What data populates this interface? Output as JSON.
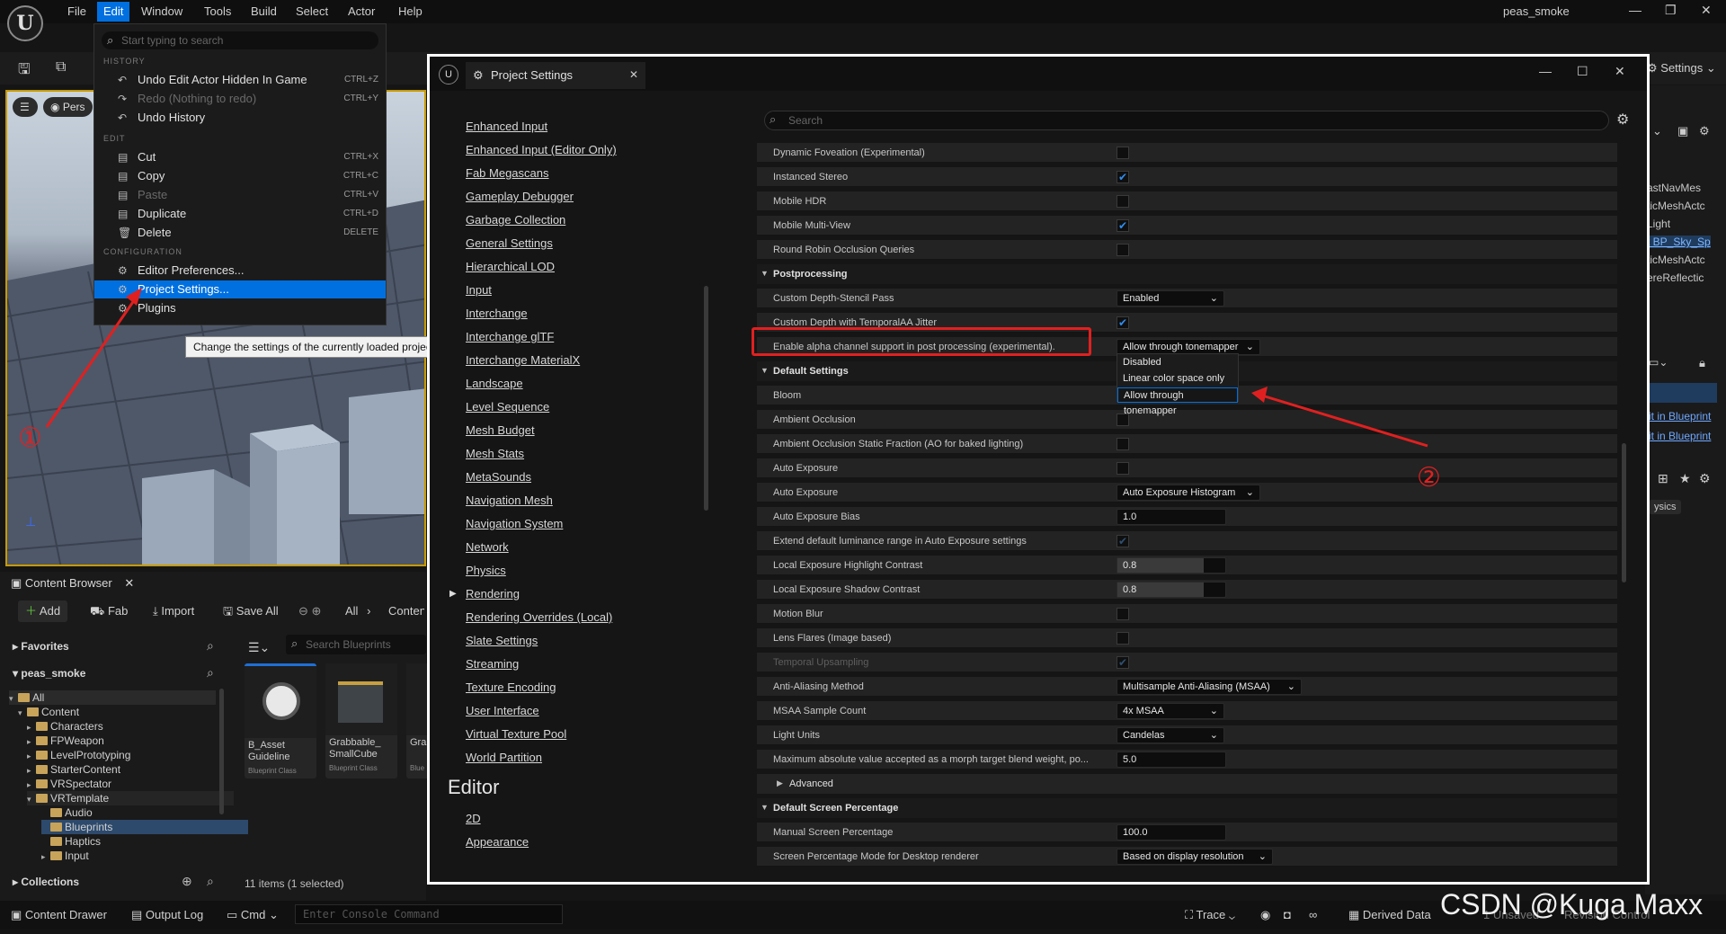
{
  "main": {
    "menus": [
      "File",
      "Edit",
      "Window",
      "Tools",
      "Build",
      "Select",
      "Actor",
      "Help"
    ],
    "active_menu": "Edit",
    "project_name": "peas_smoke",
    "settings_label": "Settings"
  },
  "edit_menu": {
    "search_placeholder": "Start typing to search",
    "history_header": "HISTORY",
    "edit_header": "EDIT",
    "config_header": "CONFIGURATION",
    "history": [
      {
        "label": "Undo Edit Actor Hidden In Game",
        "shortcut": "CTRL+Z"
      },
      {
        "label": "Redo (Nothing to redo)",
        "shortcut": "CTRL+Y"
      },
      {
        "label": "Undo History",
        "shortcut": ""
      }
    ],
    "edit": [
      {
        "label": "Cut",
        "shortcut": "CTRL+X"
      },
      {
        "label": "Copy",
        "shortcut": "CTRL+C"
      },
      {
        "label": "Paste",
        "shortcut": "CTRL+V"
      },
      {
        "label": "Duplicate",
        "shortcut": "CTRL+D"
      },
      {
        "label": "Delete",
        "shortcut": "DELETE"
      }
    ],
    "config": [
      {
        "label": "Editor Preferences..."
      },
      {
        "label": "Project Settings..."
      },
      {
        "label": "Plugins"
      }
    ],
    "tooltip": "Change the settings of the currently loaded project"
  },
  "viewport": {
    "view_label": "Pers"
  },
  "content_browser": {
    "title": "Content Browser",
    "add": "Add",
    "fab": "Fab",
    "import": "Import",
    "save_all": "Save All",
    "path_all": "All",
    "path_content": "Content",
    "favorites": "Favorites",
    "project": "peas_smoke",
    "collections": "Collections",
    "search_placeholder": "Search Blueprints",
    "tree": [
      "All",
      "Content",
      "Characters",
      "FPWeapon",
      "LevelPrototyping",
      "StarterContent",
      "VRSpectator",
      "VRTemplate",
      "Audio",
      "Blueprints",
      "Haptics",
      "Input"
    ],
    "assets": [
      {
        "name": "B_Asset Guideline",
        "class": "Blueprint Class"
      },
      {
        "name": "Grabbable_ SmallCube",
        "class": "Blueprint Class"
      },
      {
        "name": "Grab Com",
        "class": "Blue"
      }
    ],
    "count": "11 items (1 selected)"
  },
  "statusbar": {
    "content_drawer": "Content Drawer",
    "output_log": "Output Log",
    "cmd": "Cmd",
    "console_placeholder": "Enter Console Command",
    "trace": "Trace",
    "derived_data": "Derived Data",
    "unsaved": "1 Unsaved",
    "revision": "Revision Control"
  },
  "right_panel": {
    "items": [
      "astNavMes",
      "ticMeshActc",
      "Light",
      "t BP_Sky_Sp",
      "ticMeshActc",
      "ereReflectic"
    ],
    "links": [
      "it in Blueprint",
      "it in Blueprint"
    ],
    "physics": "ysics"
  },
  "project_settings": {
    "title": "Project Settings",
    "search_placeholder": "Search",
    "nav": [
      "Enhanced Input",
      "Enhanced Input (Editor Only)",
      "Fab Megascans",
      "Gameplay Debugger",
      "Garbage Collection",
      "General Settings",
      "Hierarchical LOD",
      "Input",
      "Interchange",
      "Interchange glTF",
      "Interchange MaterialX",
      "Landscape",
      "Level Sequence",
      "Mesh Budget",
      "Mesh Stats",
      "MetaSounds",
      "Navigation Mesh",
      "Navigation System",
      "Network",
      "Physics",
      "Rendering",
      "Rendering Overrides (Local)",
      "Slate Settings",
      "Streaming",
      "Texture Encoding",
      "User Interface",
      "Virtual Texture Pool",
      "World Partition"
    ],
    "editor_header": "Editor",
    "editor_nav": [
      "2D",
      "Appearance"
    ],
    "rows": [
      {
        "type": "check",
        "name": "Dynamic Foveation (Experimental)",
        "checked": false
      },
      {
        "type": "check",
        "name": "Instanced Stereo",
        "checked": true
      },
      {
        "type": "check",
        "name": "Mobile HDR",
        "checked": false
      },
      {
        "type": "check",
        "name": "Mobile Multi-View",
        "checked": true
      },
      {
        "type": "check",
        "name": "Round Robin Occlusion Queries",
        "checked": false
      },
      {
        "type": "section",
        "name": "Postprocessing"
      },
      {
        "type": "dropdown",
        "name": "Custom Depth-Stencil Pass",
        "value": "Enabled"
      },
      {
        "type": "check",
        "name": "Custom Depth with TemporalAA Jitter",
        "checked": true
      },
      {
        "type": "dropdown",
        "name": "Enable alpha channel support in post processing (experimental).",
        "value": "Allow through tonemapper"
      },
      {
        "type": "section",
        "name": "Default Settings"
      },
      {
        "type": "blank",
        "name": "Bloom"
      },
      {
        "type": "check",
        "name": "Ambient Occlusion",
        "checked": false
      },
      {
        "type": "check",
        "name": "Ambient Occlusion Static Fraction (AO for baked lighting)",
        "checked": false
      },
      {
        "type": "check",
        "name": "Auto Exposure",
        "checked": false
      },
      {
        "type": "dropdown",
        "name": "Auto Exposure",
        "value": "Auto Exposure Histogram"
      },
      {
        "type": "number",
        "name": "Auto Exposure Bias",
        "value": "1.0"
      },
      {
        "type": "check",
        "name": "Extend default luminance range in Auto Exposure settings",
        "checked": true,
        "disabled": true
      },
      {
        "type": "number",
        "name": "Local Exposure Highlight Contrast",
        "value": "0.8",
        "fill": 0.8
      },
      {
        "type": "number",
        "name": "Local Exposure Shadow Contrast",
        "value": "0.8",
        "fill": 0.8
      },
      {
        "type": "check",
        "name": "Motion Blur",
        "checked": false
      },
      {
        "type": "check",
        "name": "Lens Flares (Image based)",
        "checked": false
      },
      {
        "type": "check",
        "name": "Temporal Upsampling",
        "checked": true,
        "disabled": true,
        "dimname": true
      },
      {
        "type": "dropdown",
        "name": "Anti-Aliasing Method",
        "value": "Multisample Anti-Aliasing (MSAA)"
      },
      {
        "type": "dropdown",
        "name": "MSAA Sample Count",
        "value": "4x MSAA"
      },
      {
        "type": "dropdown",
        "name": "Light Units",
        "value": "Candelas"
      },
      {
        "type": "number",
        "name": "Maximum absolute value accepted as a morph target blend weight, po...",
        "value": "5.0"
      },
      {
        "type": "subsection",
        "name": "Advanced"
      },
      {
        "type": "section",
        "name": "Default Screen Percentage"
      },
      {
        "type": "number",
        "name": "Manual Screen Percentage",
        "value": "100.0"
      },
      {
        "type": "dropdown",
        "name": "Screen Percentage Mode for Desktop renderer",
        "value": "Based on display resolution"
      }
    ],
    "dropdown_options": [
      "Disabled",
      "Linear color space only",
      "Allow through tonemapper"
    ],
    "dropdown_selected": "Allow through tonemapper"
  },
  "annotations": {
    "one": "①",
    "two": "②",
    "color": "#e02020"
  },
  "watermark": "CSDN @Kuga Maxx"
}
